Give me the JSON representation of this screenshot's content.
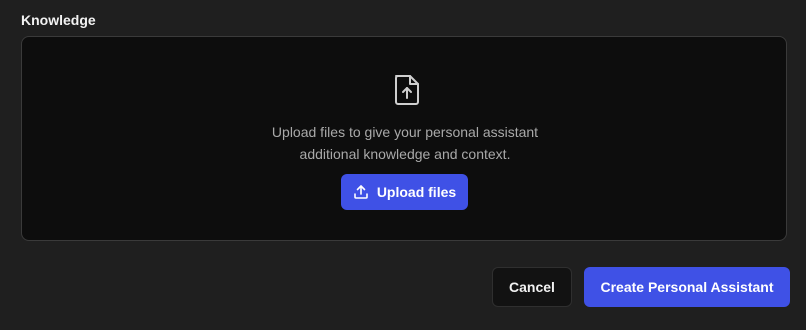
{
  "knowledge": {
    "title": "Knowledge",
    "hint_line1": "Upload files to give your personal assistant",
    "hint_line2": "additional knowledge and context.",
    "upload_label": "Upload files",
    "icons": {
      "file": "file-upload-icon",
      "upload": "upload-icon"
    }
  },
  "actions": {
    "cancel_label": "Cancel",
    "create_label": "Create Personal Assistant"
  },
  "colors": {
    "background": "#1f1f1f",
    "dropzone": "#0d0d0d",
    "accent": "#3f51e6",
    "muted_text": "#a9a9a9"
  }
}
